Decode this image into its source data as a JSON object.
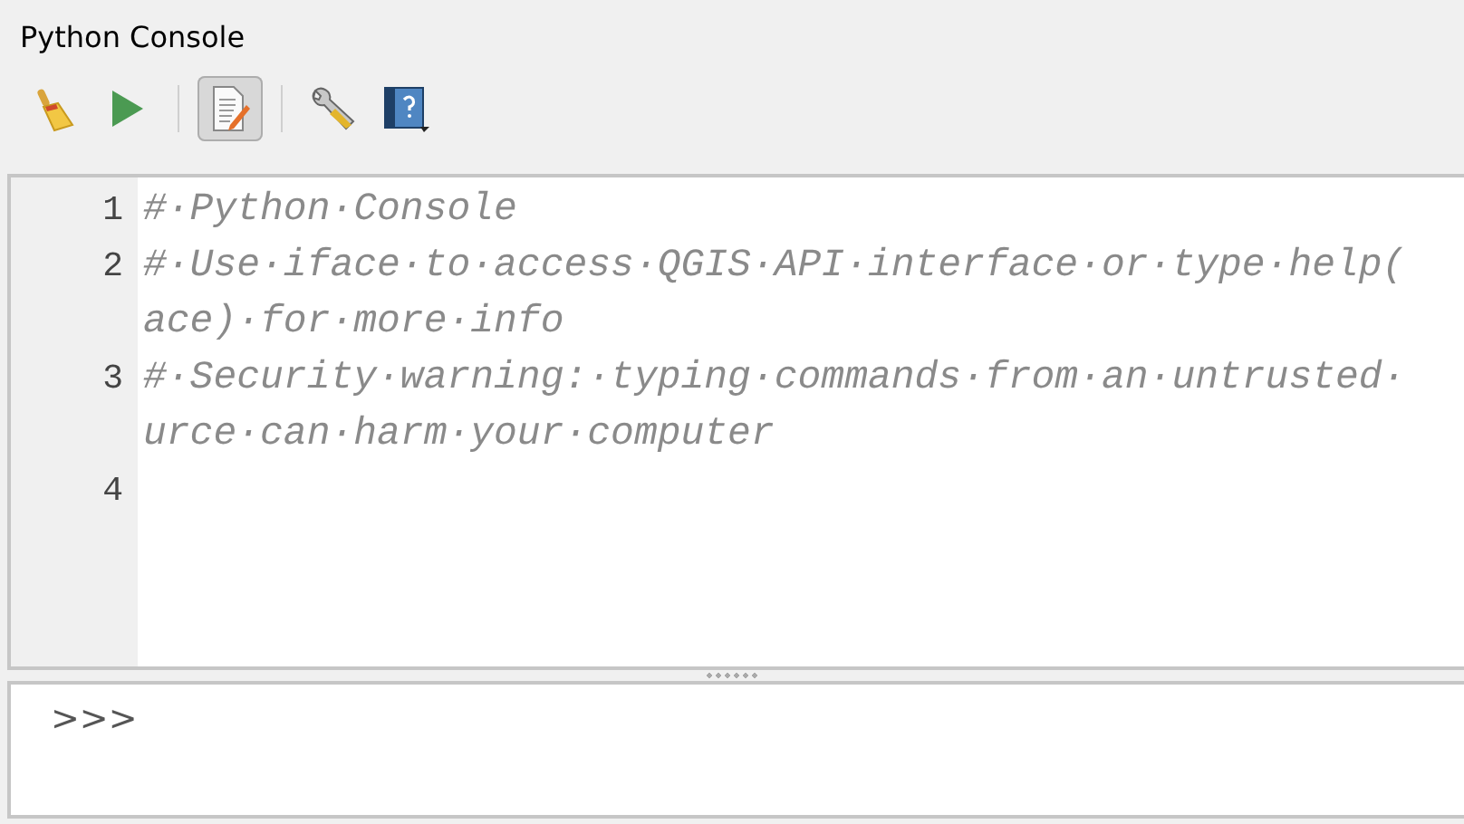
{
  "panel": {
    "title": "Python Console"
  },
  "toolbar": [
    {
      "kind": "button",
      "selected": false
    },
    {
      "kind": "button",
      "selected": false
    },
    {
      "kind": "separator"
    },
    {
      "kind": "button",
      "selected": true
    },
    {
      "kind": "separator"
    },
    {
      "kind": "button",
      "selected": false
    },
    {
      "kind": "button",
      "selected": false
    }
  ],
  "editor": {
    "lines": [
      {
        "number": "1",
        "segments": [
          "#·Python·Console"
        ]
      },
      {
        "number": "2",
        "segments": [
          "#·Use·iface·to·access·QGIS·API·interface·or·type·help(",
          "ace)·for·more·info"
        ]
      },
      {
        "number": "3",
        "segments": [
          "#·Security·warning:·typing·commands·from·an·untrusted·",
          "urce·can·harm·your·computer"
        ]
      },
      {
        "number": "4"
      }
    ]
  },
  "input": {
    "prompt": ">>>"
  }
}
